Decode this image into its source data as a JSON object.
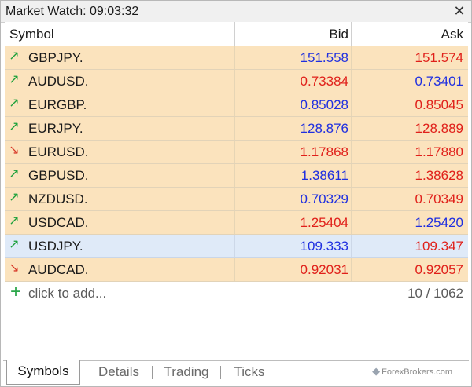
{
  "window": {
    "title": "Market Watch: 09:03:32",
    "close_icon": "✕"
  },
  "columns": {
    "symbol": "Symbol",
    "bid": "Bid",
    "ask": "Ask"
  },
  "rows": [
    {
      "symbol": "GBPJPY.",
      "direction": "up",
      "bid": "151.558",
      "bid_color": "blue",
      "ask": "151.574",
      "ask_color": "red"
    },
    {
      "symbol": "AUDUSD.",
      "direction": "up",
      "bid": "0.73384",
      "bid_color": "red",
      "ask": "0.73401",
      "ask_color": "blue"
    },
    {
      "symbol": "EURGBP.",
      "direction": "up",
      "bid": "0.85028",
      "bid_color": "blue",
      "ask": "0.85045",
      "ask_color": "red"
    },
    {
      "symbol": "EURJPY.",
      "direction": "up",
      "bid": "128.876",
      "bid_color": "blue",
      "ask": "128.889",
      "ask_color": "red"
    },
    {
      "symbol": "EURUSD.",
      "direction": "down",
      "bid": "1.17868",
      "bid_color": "red",
      "ask": "1.17880",
      "ask_color": "red"
    },
    {
      "symbol": "GBPUSD.",
      "direction": "up",
      "bid": "1.38611",
      "bid_color": "blue",
      "ask": "1.38628",
      "ask_color": "red"
    },
    {
      "symbol": "NZDUSD.",
      "direction": "up",
      "bid": "0.70329",
      "bid_color": "blue",
      "ask": "0.70349",
      "ask_color": "red"
    },
    {
      "symbol": "USDCAD.",
      "direction": "up",
      "bid": "1.25404",
      "bid_color": "red",
      "ask": "1.25420",
      "ask_color": "blue"
    },
    {
      "symbol": "USDJPY.",
      "direction": "up",
      "bid": "109.333",
      "bid_color": "blue",
      "ask": "109.347",
      "ask_color": "red",
      "selected": true
    },
    {
      "symbol": "AUDCAD.",
      "direction": "down",
      "bid": "0.92031",
      "bid_color": "red",
      "ask": "0.92057",
      "ask_color": "red"
    }
  ],
  "add_row": {
    "label": "click to add...",
    "count": "10 / 1062"
  },
  "tabs": [
    {
      "label": "Symbols",
      "active": true
    },
    {
      "label": "Details",
      "active": false
    },
    {
      "label": "Trading",
      "active": false
    },
    {
      "label": "Ticks",
      "active": false
    }
  ],
  "watermark": "ForexBrokers.com",
  "colors": {
    "row_bg": "#fbe3bd",
    "selected_bg": "#dfeaf8",
    "blue": "#1f2fe0",
    "red": "#e0201a",
    "up_arrow": "#1aa03a",
    "down_arrow": "#d83a2a"
  },
  "icons": {
    "up": "up-arrow-icon",
    "down": "down-arrow-icon",
    "add": "plus-icon",
    "close": "close-icon"
  }
}
